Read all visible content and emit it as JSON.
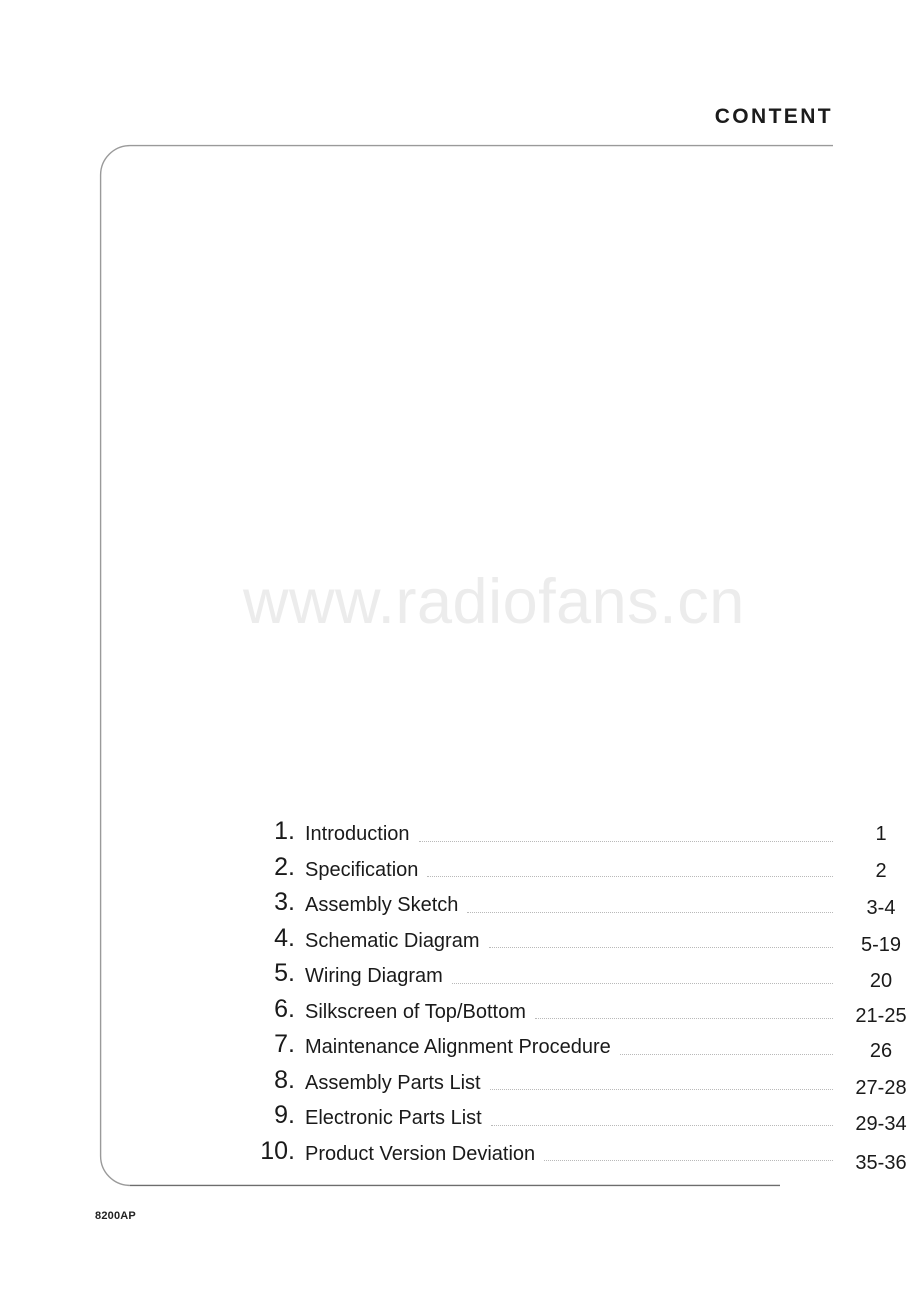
{
  "header": {
    "title": "CONTENT"
  },
  "watermark": {
    "text": "www.radiofans.cn",
    "color": "#ececec"
  },
  "frame": {
    "border_color": "#9a9a9a",
    "corner_radius": 30
  },
  "toc": {
    "entries": [
      {
        "number": "1.",
        "label": "Introduction",
        "page": "1"
      },
      {
        "number": "2.",
        "label": "Specification",
        "page": "2"
      },
      {
        "number": "3.",
        "label": "Assembly Sketch",
        "page": "3-4"
      },
      {
        "number": "4.",
        "label": "Schematic Diagram",
        "page": "5-19"
      },
      {
        "number": "5.",
        "label": "Wiring Diagram",
        "page": "20"
      },
      {
        "number": "6.",
        "label": "Silkscreen of Top/Bottom",
        "page": "21-25"
      },
      {
        "number": "7.",
        "label": "Maintenance Alignment Procedure",
        "page": "26"
      },
      {
        "number": "8.",
        "label": "Assembly Parts List",
        "page": "27-28"
      },
      {
        "number": "9.",
        "label": "Electronic Parts List",
        "page": "29-34"
      },
      {
        "number": "10.",
        "label": "Product Version Deviation",
        "page": "35-36"
      }
    ]
  },
  "footer": {
    "model": "8200AP"
  }
}
